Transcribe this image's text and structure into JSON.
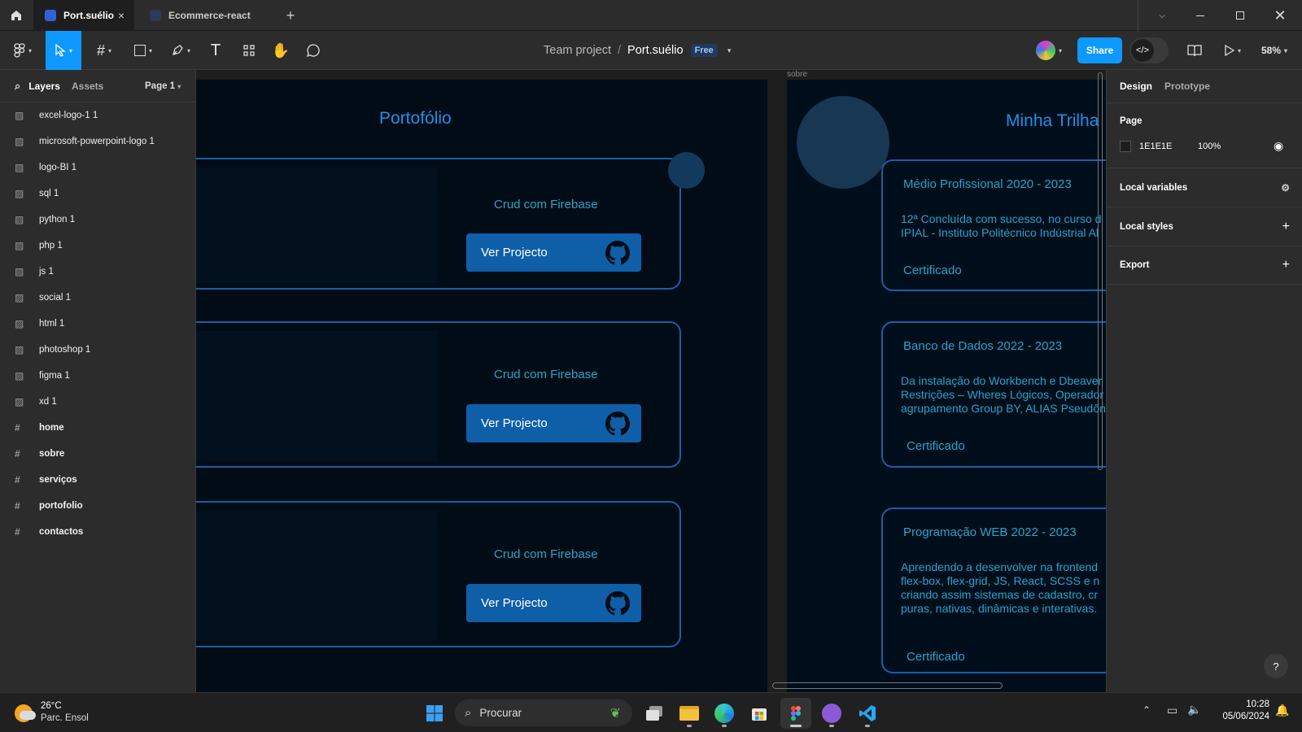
{
  "tabs": [
    {
      "label": "Port.suélio",
      "active": true
    },
    {
      "label": "Ecommerce-react",
      "active": false
    }
  ],
  "toolbar": {
    "breadcrumb_team": "Team project",
    "breadcrumb_sep": "/",
    "file_name": "Port.suélio",
    "plan_badge": "Free",
    "share_label": "Share",
    "zoom": "58%"
  },
  "left_panel": {
    "tab_layers": "Layers",
    "tab_assets": "Assets",
    "page_selector": "Page 1",
    "layers": [
      {
        "name": "excel-logo-1 1",
        "type": "image"
      },
      {
        "name": "microsoft-powerpoint-logo 1",
        "type": "image"
      },
      {
        "name": "logo-BI 1",
        "type": "image"
      },
      {
        "name": "sql 1",
        "type": "image"
      },
      {
        "name": "python 1",
        "type": "image"
      },
      {
        "name": "php 1",
        "type": "image"
      },
      {
        "name": "js 1",
        "type": "image"
      },
      {
        "name": "social 1",
        "type": "image"
      },
      {
        "name": "html 1",
        "type": "image"
      },
      {
        "name": "photoshop 1",
        "type": "image"
      },
      {
        "name": "figma 1",
        "type": "image"
      },
      {
        "name": "xd 1",
        "type": "image"
      },
      {
        "name": "home",
        "type": "frame"
      },
      {
        "name": "sobre",
        "type": "frame"
      },
      {
        "name": "serviços",
        "type": "frame"
      },
      {
        "name": "portofolio",
        "type": "frame"
      },
      {
        "name": "contactos",
        "type": "frame"
      }
    ]
  },
  "canvas": {
    "frame_label_sobre": "sobre",
    "portfolio": {
      "heading": "Portofólio",
      "cards": [
        {
          "title": "Crud com Firebase",
          "button": "Ver Projecto"
        },
        {
          "title": "Crud com Firebase",
          "button": "Ver Projecto"
        },
        {
          "title": "Crud com Firebase",
          "button": "Ver Projecto"
        }
      ]
    },
    "sobre": {
      "heading": "Minha Trilha",
      "cards": [
        {
          "title": "Médio Profissional  2020 - 2023",
          "lines": [
            "12ª Concluída com sucesso, no curso d",
            "IPIAL - Instituto Politécnico Indústrial Al"
          ],
          "cert": "Certificado"
        },
        {
          "title": "Banco de Dados  2022 - 2023",
          "lines": [
            "Da instalação do Workbench e Dbeaver",
            "Restrições – Wheres Lógicos, Operador",
            "agrupamento Group BY, ALIAS Pseudôn"
          ],
          "cert": "Certificado"
        },
        {
          "title": "Programação WEB  2022 - 2023",
          "lines": [
            "Aprendendo a desenvolver na frontend",
            "flex-box, flex-grid, JS, React, SCSS e n",
            "criando assim sistemas de cadastro, cr",
            "puras, nativas, dinâmicas e interativas."
          ],
          "cert": "Certificado"
        }
      ]
    }
  },
  "right_panel": {
    "tab_design": "Design",
    "tab_prototype": "Prototype",
    "page_heading": "Page",
    "page_color_hex": "1E1E1E",
    "page_opacity": "100%",
    "local_variables": "Local variables",
    "local_styles": "Local styles",
    "export": "Export",
    "help": "?"
  },
  "taskbar": {
    "weather_temp": "26°C",
    "weather_desc": "Parc. Ensol",
    "search_placeholder": "Procurar",
    "time": "10:28",
    "date": "05/06/2024"
  },
  "colors": {
    "accent": "#0d99ff",
    "frame_bg": "#020c17",
    "card_border": "#1a5fa8",
    "card_text": "#29a6c4",
    "button_bg": "#0e5fa8",
    "heading_blue": "#1e90e6"
  }
}
